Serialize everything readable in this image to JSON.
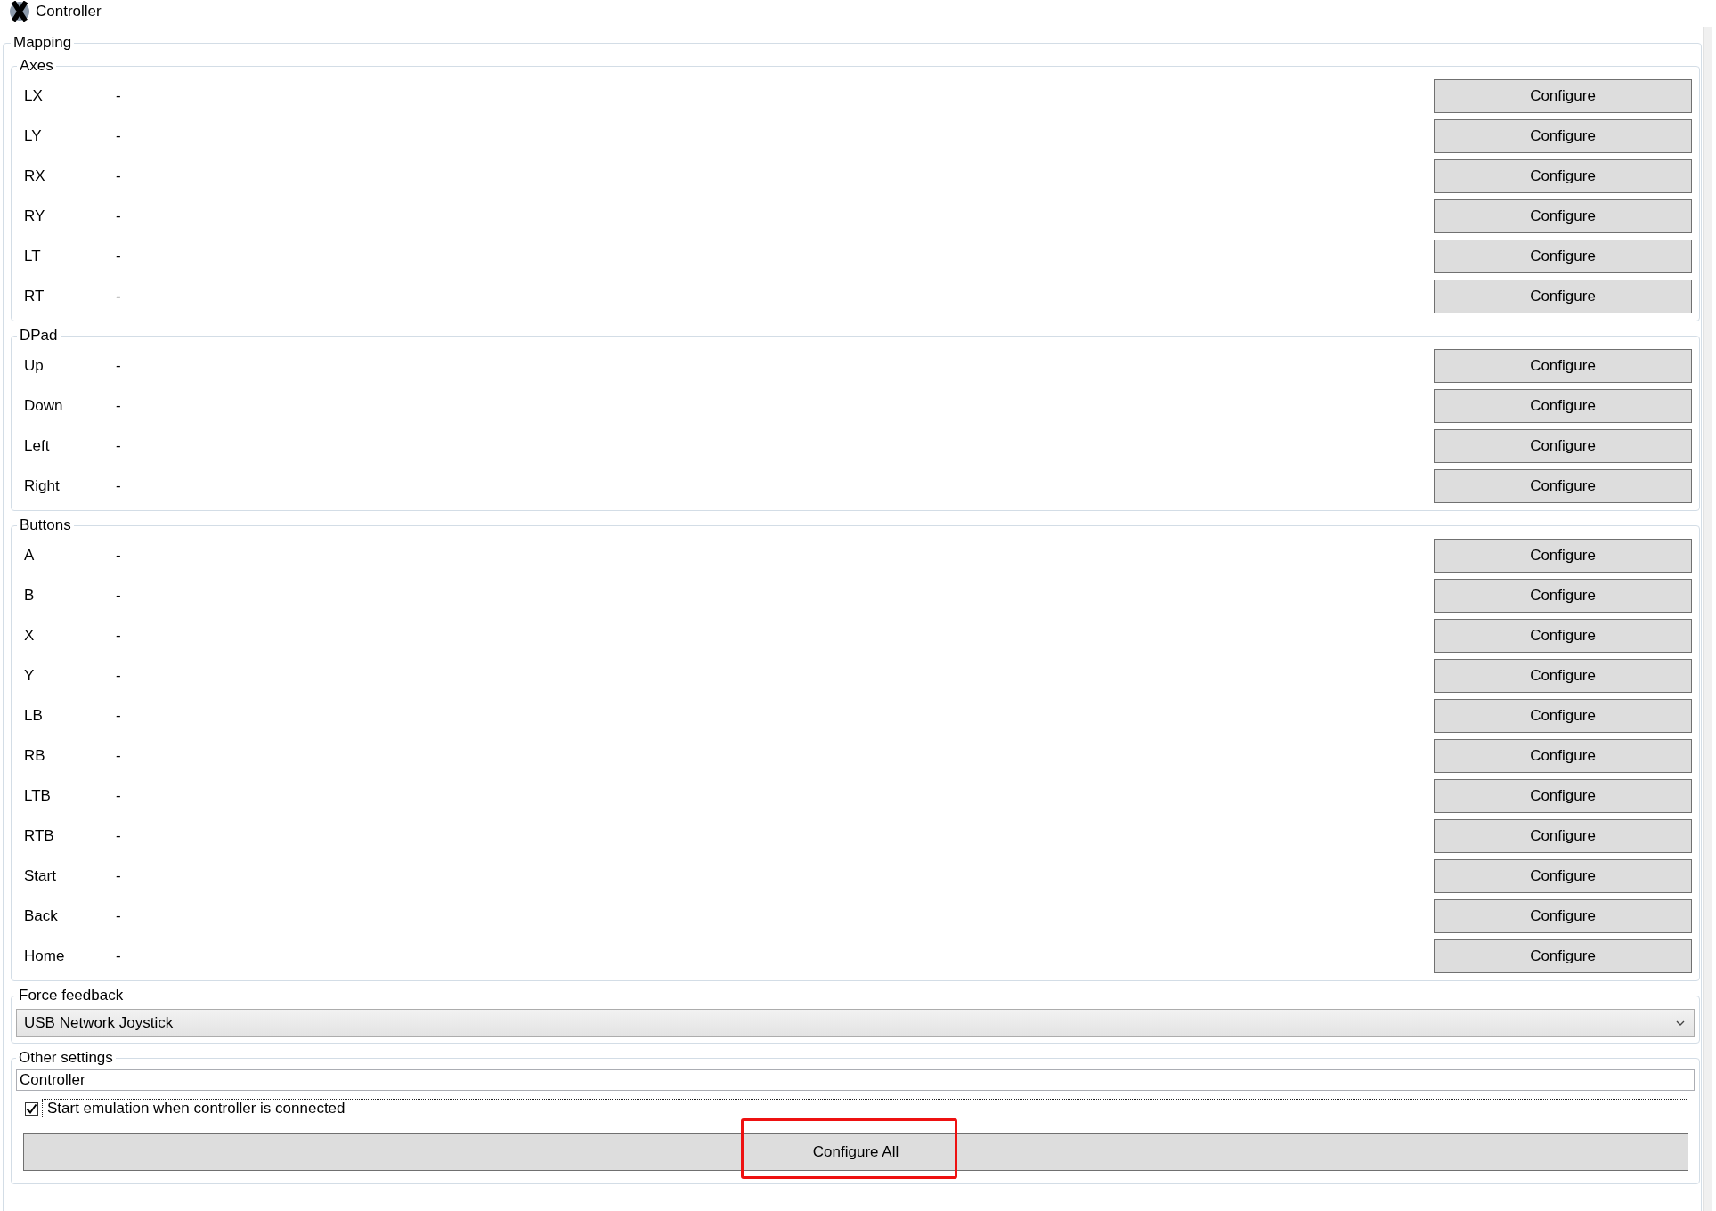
{
  "window": {
    "title": "Controller"
  },
  "mapping": {
    "title": "Mapping",
    "groups": [
      {
        "title": "Axes",
        "rows": [
          {
            "label": "LX",
            "value": "-",
            "button": "Configure"
          },
          {
            "label": "LY",
            "value": "-",
            "button": "Configure"
          },
          {
            "label": "RX",
            "value": "-",
            "button": "Configure"
          },
          {
            "label": "RY",
            "value": "-",
            "button": "Configure"
          },
          {
            "label": "LT",
            "value": "-",
            "button": "Configure"
          },
          {
            "label": "RT",
            "value": "-",
            "button": "Configure"
          }
        ]
      },
      {
        "title": "DPad",
        "rows": [
          {
            "label": "Up",
            "value": "-",
            "button": "Configure"
          },
          {
            "label": "Down",
            "value": "-",
            "button": "Configure"
          },
          {
            "label": "Left",
            "value": "-",
            "button": "Configure"
          },
          {
            "label": "Right",
            "value": "-",
            "button": "Configure"
          }
        ]
      },
      {
        "title": "Buttons",
        "rows": [
          {
            "label": "A",
            "value": "-",
            "button": "Configure"
          },
          {
            "label": "B",
            "value": "-",
            "button": "Configure"
          },
          {
            "label": "X",
            "value": "-",
            "button": "Configure"
          },
          {
            "label": "Y",
            "value": "-",
            "button": "Configure"
          },
          {
            "label": "LB",
            "value": "-",
            "button": "Configure"
          },
          {
            "label": "RB",
            "value": "-",
            "button": "Configure"
          },
          {
            "label": "LTB",
            "value": "-",
            "button": "Configure"
          },
          {
            "label": "RTB",
            "value": "-",
            "button": "Configure"
          },
          {
            "label": "Start",
            "value": "-",
            "button": "Configure"
          },
          {
            "label": "Back",
            "value": "-",
            "button": "Configure"
          },
          {
            "label": "Home",
            "value": "-",
            "button": "Configure"
          }
        ]
      }
    ]
  },
  "force_feedback": {
    "title": "Force feedback",
    "dropdown": {
      "value": "USB Network Joystick"
    }
  },
  "other_settings": {
    "title": "Other settings",
    "name_field": {
      "value": "Controller"
    },
    "checkbox": {
      "label": "Start emulation when controller is connected",
      "checked": true,
      "focused": true
    },
    "configure_all": {
      "label": "Configure All",
      "highlighted": true
    }
  }
}
